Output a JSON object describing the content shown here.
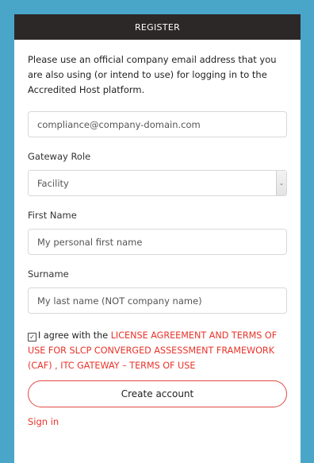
{
  "header": {
    "title": "REGISTER"
  },
  "intro": {
    "text": "Please use an official company email address that you are also using (or intend to use) for logging in to the Accredited Host platform."
  },
  "email": {
    "placeholder": "compliance@company-domain.com"
  },
  "gateway_role": {
    "label": "Gateway Role",
    "selected": "Facility"
  },
  "first_name": {
    "label": "First Name",
    "placeholder": "My personal first name"
  },
  "surname": {
    "label": "Surname",
    "placeholder": "My last name (NOT company name)"
  },
  "agreement": {
    "prefix": "I agree with the",
    "link_text": "LICENSE AGREEMENT AND TERMS OF USE FOR SLCP CONVERGED ASSESSMENT FRAMEWORK (CAF) , ITC GATEWAY – TERMS OF USE",
    "checked": true
  },
  "actions": {
    "create_account": "Create account",
    "sign_in": "Sign in"
  },
  "colors": {
    "background": "#4aa6c9",
    "header": "#2c2828",
    "accent": "#e8332a"
  },
  "icons": {
    "checkbox": "checkbox-checked-icon",
    "select_arrow": "chevron-down-icon"
  }
}
